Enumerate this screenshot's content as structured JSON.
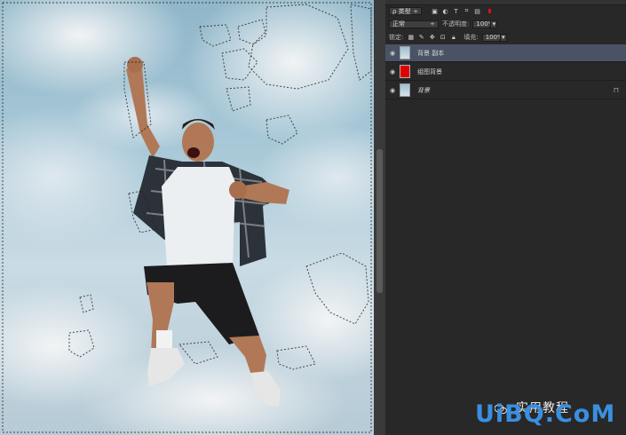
{
  "panel": {
    "filter_kind": "ρ 类型",
    "blend_mode": "正常",
    "opacity_label": "不透明度:",
    "opacity_value": "100%",
    "lock_label": "锁定:",
    "fill_label": "填充:",
    "fill_value": "100%",
    "layers": [
      {
        "name": "背景 副本",
        "selected": true,
        "thumb": "photo",
        "locked": false
      },
      {
        "name": "组图背景",
        "selected": false,
        "thumb": "red",
        "locked": false
      },
      {
        "name": "背景",
        "selected": false,
        "thumb": "photo",
        "locked": true
      }
    ]
  },
  "watermark": {
    "brand": "UiBQ.CoM",
    "cn_text": "实用教程"
  },
  "colors": {
    "selected_layer": "#4a5266",
    "red_fill": "#e00000",
    "watermark_blue": "#3a8fe0"
  }
}
